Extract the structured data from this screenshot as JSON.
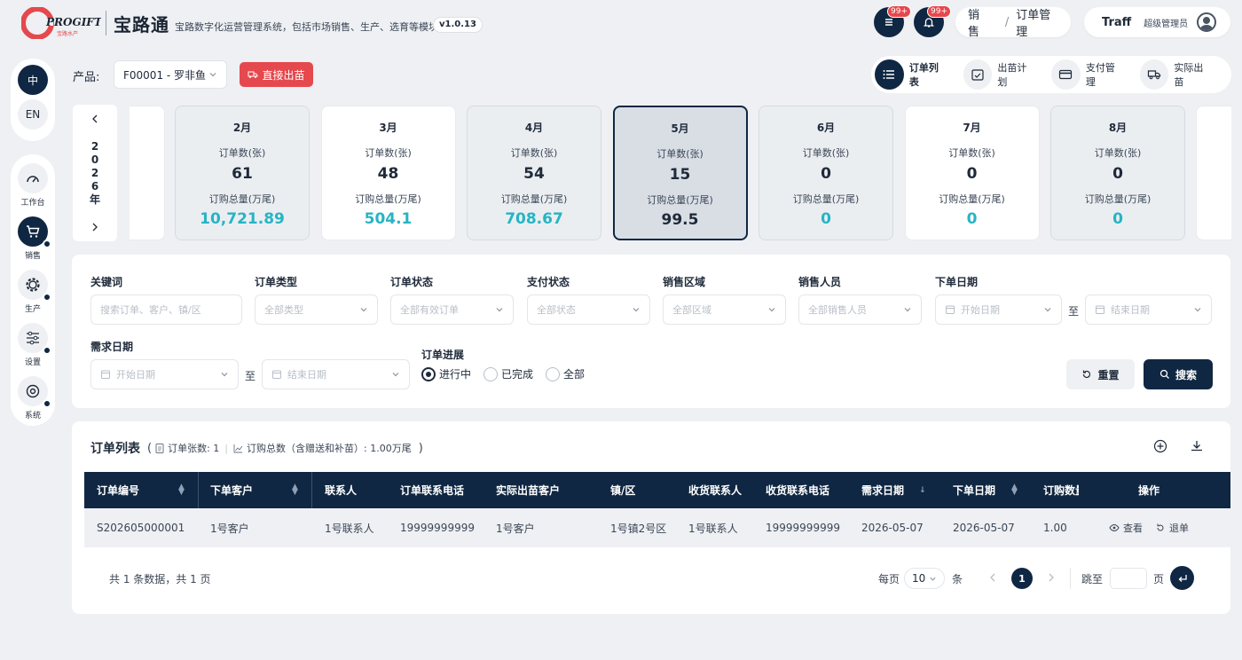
{
  "header": {
    "brand_name": "宝路通",
    "logo_text": "PROGIFT",
    "logo_sub": "宝路水产",
    "subtitle": "宝路数字化运营管理系统，包括市场销售、生产、选育等模块",
    "version": "v1.0.13",
    "tasks_badge": "99+",
    "notify_badge": "99+",
    "breadcrumb": [
      "销售",
      "订单管理"
    ],
    "breadcrumb_sep": "/",
    "user_name": "Traff",
    "user_role": "超级管理员"
  },
  "lang": {
    "zh": "中",
    "en": "EN"
  },
  "sidebar": {
    "items": [
      {
        "label": "工作台",
        "icon": "dashboard-gauge-icon"
      },
      {
        "label": "销售",
        "icon": "shopping-cart-icon",
        "active": true
      },
      {
        "label": "生产",
        "icon": "gear-icon"
      },
      {
        "label": "设置",
        "icon": "sliders-icon"
      },
      {
        "label": "系统",
        "icon": "cog-icon"
      }
    ]
  },
  "toolbar": {
    "product_label": "产品:",
    "product_value": "F00001 - 罗非鱼",
    "direct_label": "直接出苗"
  },
  "view_tabs": [
    {
      "label": "订单列表",
      "icon": "list-icon",
      "active": true
    },
    {
      "label": "出苗计划",
      "icon": "calendar-check-icon"
    },
    {
      "label": "支付管理",
      "icon": "credit-card-icon"
    },
    {
      "label": "实际出苗",
      "icon": "truck-icon"
    }
  ],
  "year": "2026年",
  "month_cards": [
    {
      "month": "2月",
      "count_label": "订单数(张)",
      "count": "61",
      "total_label": "订购总量(万尾)",
      "total": "10,721.89",
      "style": "g"
    },
    {
      "month": "3月",
      "count_label": "订单数(张)",
      "count": "48",
      "total_label": "订购总量(万尾)",
      "total": "504.1",
      "style": "w"
    },
    {
      "month": "4月",
      "count_label": "订单数(张)",
      "count": "54",
      "total_label": "订购总量(万尾)",
      "total": "708.67",
      "style": "g"
    },
    {
      "month": "5月",
      "count_label": "订单数(张)",
      "count": "15",
      "total_label": "订购总量(万尾)",
      "total": "99.5",
      "style": "sel"
    },
    {
      "month": "6月",
      "count_label": "订单数(张)",
      "count": "0",
      "total_label": "订购总量(万尾)",
      "total": "0",
      "style": "g"
    },
    {
      "month": "7月",
      "count_label": "订单数(张)",
      "count": "0",
      "total_label": "订购总量(万尾)",
      "total": "0",
      "style": "w"
    },
    {
      "month": "8月",
      "count_label": "订单数(张)",
      "count": "0",
      "total_label": "订购总量(万尾)",
      "total": "0",
      "style": "g"
    }
  ],
  "filters": {
    "keyword": {
      "label": "关键词",
      "placeholder": "搜索订单、客户、镇/区"
    },
    "order_type": {
      "label": "订单类型",
      "placeholder": "全部类型"
    },
    "order_status": {
      "label": "订单状态",
      "placeholder": "全部有效订单"
    },
    "pay_status": {
      "label": "支付状态",
      "placeholder": "全部状态"
    },
    "region": {
      "label": "销售区域",
      "placeholder": "全部区域"
    },
    "salesman": {
      "label": "销售人员",
      "placeholder": "全部销售人员"
    },
    "order_date": {
      "label": "下单日期",
      "start": "开始日期",
      "end": "结束日期"
    },
    "demand_date": {
      "label": "需求日期",
      "start": "开始日期",
      "end": "结束日期"
    },
    "to": "至",
    "progress": {
      "label": "订单进展",
      "options": [
        "进行中",
        "已完成",
        "全部"
      ],
      "selected": "进行中"
    },
    "reset": "重置",
    "search": "搜索"
  },
  "list": {
    "title": "订单列表",
    "count_text": "订单张数: 1",
    "total_text": "订购总数（含赠送和补苗）: 1.00万尾",
    "columns": [
      "订单编号",
      "下单客户",
      "联系人",
      "订单联系电话",
      "实际出苗客户",
      "镇/区",
      "收货联系人",
      "收货联系电话",
      "需求日期",
      "下单日期",
      "订购数量",
      "操作"
    ],
    "rows": [
      {
        "order_no": "S202605000001",
        "customer": "1号客户",
        "contact": "1号联系人",
        "phone": "19999999999",
        "actual_customer": "1号客户",
        "town": "1号镇2号区",
        "receiver": "1号联系人",
        "receiver_phone": "19999999999",
        "demand_date": "2026-05-07",
        "order_date": "2026-05-07",
        "qty": "1.00",
        "view": "查看",
        "refund": "退单"
      }
    ]
  },
  "pagination": {
    "summary": "共 1 条数据，共 1 页",
    "per_page_label": "每页",
    "per_page": "10",
    "unit": "条",
    "current": "1",
    "jump_label": "跳至",
    "page_unit": "页"
  }
}
